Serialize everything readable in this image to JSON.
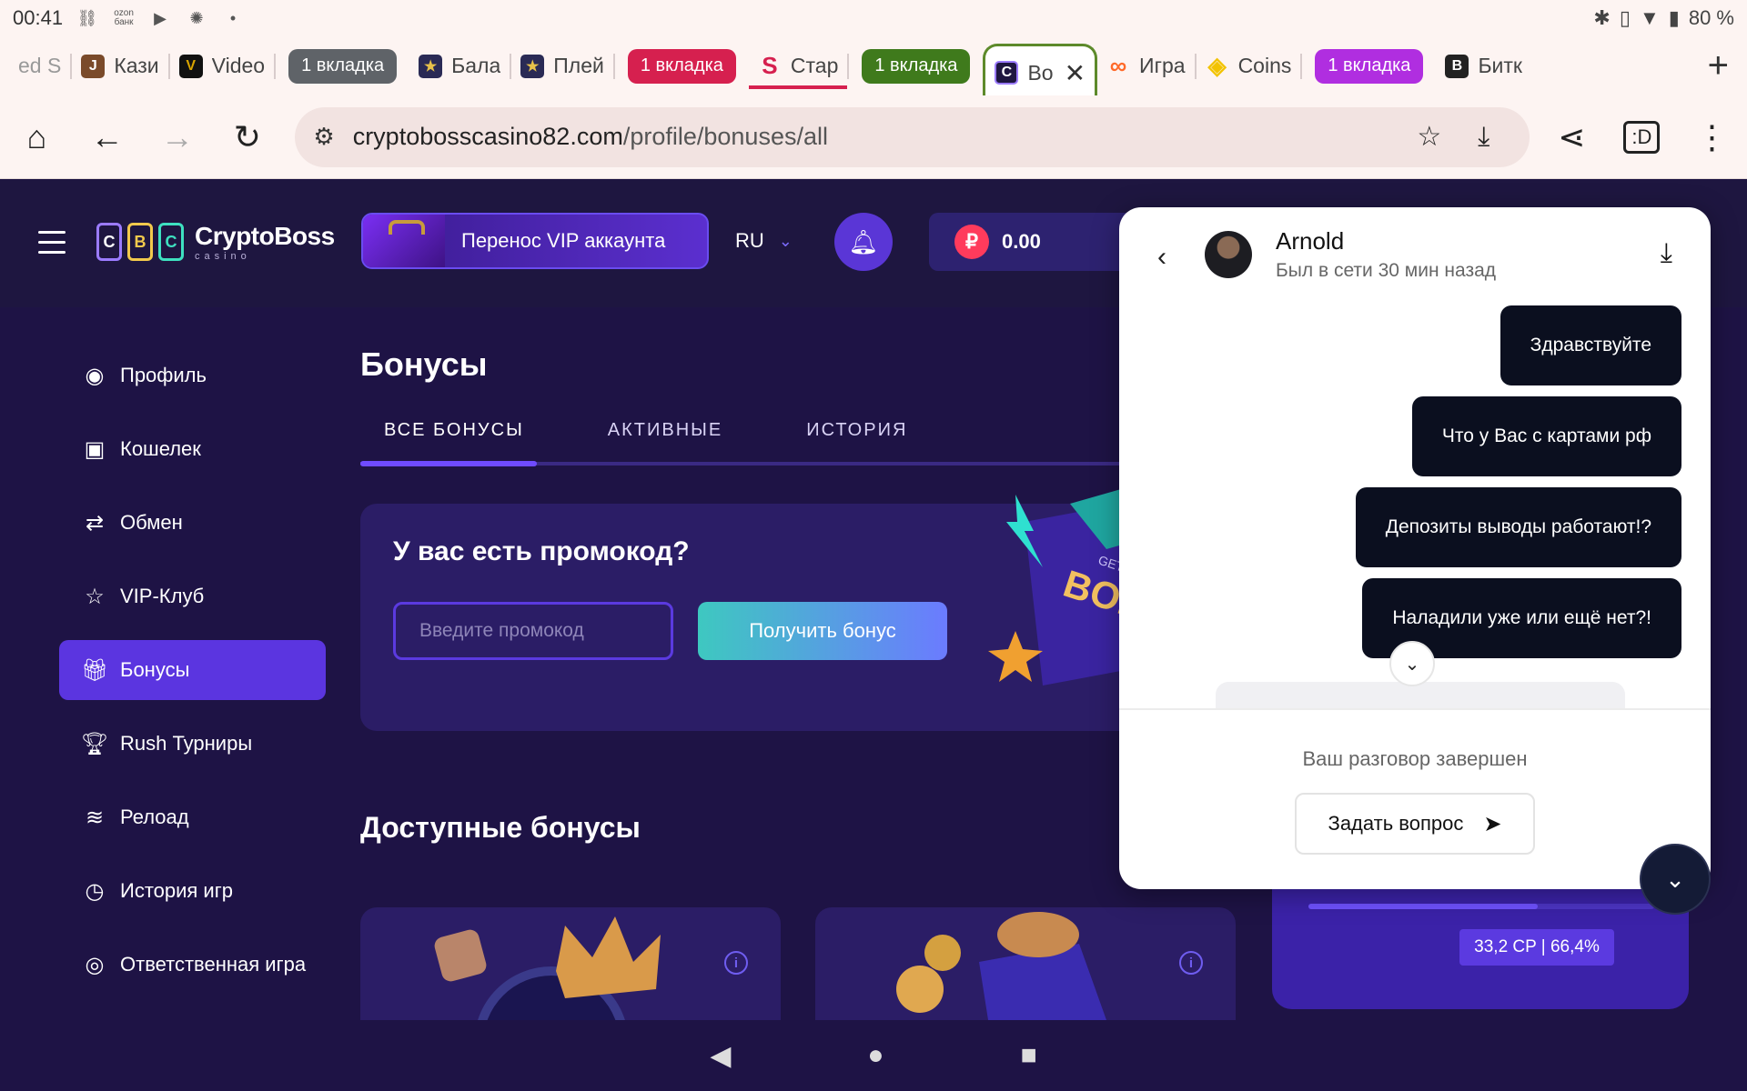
{
  "status_bar": {
    "time": "00:41",
    "icons": [
      "vpn-icon",
      "ozon-bank-icon",
      "youtube-icon",
      "sun-icon"
    ],
    "ozon_label": "ozon\nбанк",
    "dot": "•",
    "battery": "80 %"
  },
  "tabs": {
    "items": [
      {
        "label": "ed S",
        "favicon": ""
      },
      {
        "label": "Кази",
        "favicon": "J",
        "color": "#7a4a2a"
      },
      {
        "label": "Video",
        "favicon": "V",
        "color": "#d9a400"
      },
      {
        "group": "1 вкладка",
        "color": "#5f6368"
      },
      {
        "label": "Бала",
        "favicon": "★",
        "color": "#2a2a55"
      },
      {
        "label": "Плей",
        "favicon": "★",
        "color": "#2a2a55"
      },
      {
        "group": "1 вкладка",
        "color": "#d6204f"
      },
      {
        "label": "Стар",
        "favicon": "S",
        "color": "#fff",
        "favicon_text": "#d6204f"
      },
      {
        "group": "1 вкладка",
        "color": "#3f7a1c"
      },
      {
        "label": "Во",
        "favicon": "C",
        "color": "#1e1640",
        "active": true
      },
      {
        "label": "Игра",
        "favicon": "∞",
        "color": "#ff6a2a"
      },
      {
        "label": "Coins",
        "favicon": "◈",
        "color": "#f2c300"
      },
      {
        "group": "1 вкладка",
        "color": "#b02ee0"
      },
      {
        "label": "Битк",
        "favicon": "B",
        "color": "#222"
      }
    ],
    "new_tab": "+"
  },
  "toolbar": {
    "url_host": "cryptobosscasino82.com",
    "url_path": "/profile/bonuses/all"
  },
  "header": {
    "logo_letters": [
      "C",
      "B",
      "C"
    ],
    "logo_name": "CryptoBoss",
    "logo_sub": "casino",
    "vip_transfer": "Перенос VIP аккаунта",
    "lang": "RU",
    "balance_symbol": "₽",
    "balance": "0.00"
  },
  "sidebar": {
    "items": [
      {
        "label": "Профиль",
        "icon": "user-icon"
      },
      {
        "label": "Кошелек",
        "icon": "wallet-icon"
      },
      {
        "label": "Обмен",
        "icon": "exchange-icon"
      },
      {
        "label": "VIP-Клуб",
        "icon": "star-icon"
      },
      {
        "label": "Бонусы",
        "icon": "gift-icon",
        "active": true
      },
      {
        "label": "Rush Турниры",
        "icon": "trophy-icon"
      },
      {
        "label": "Релоад",
        "icon": "coins-icon"
      },
      {
        "label": "История игр",
        "icon": "clock-icon"
      },
      {
        "label": "Ответственная игра",
        "icon": "eye-icon"
      }
    ]
  },
  "main": {
    "title": "Бонусы",
    "tabs": [
      "ВСЕ БОНУСЫ",
      "АКТИВНЫЕ",
      "ИСТОРИЯ"
    ],
    "promo_title": "У вас есть промокод?",
    "promo_placeholder": "Введите промокод",
    "promo_button": "Получить бонус",
    "bonus_art_text": "BONU",
    "bonus_art_small": "GET",
    "available_title": "Доступные бонусы",
    "info_glyph": "i",
    "vip_progress": 0.664,
    "vip_progress_label": "33,2 CP | 66,4%"
  },
  "chat": {
    "agent_name": "Arnold",
    "agent_status": "Был в сети 30 мин назад",
    "messages": [
      "Здравствуйте",
      "Что у Вас с картами рф",
      "Депозиты выводы работают!?",
      "Наладили уже или ещё нет?!"
    ],
    "ended_text": "Ваш разговор завершен",
    "ask_button": "Задать вопрос"
  }
}
